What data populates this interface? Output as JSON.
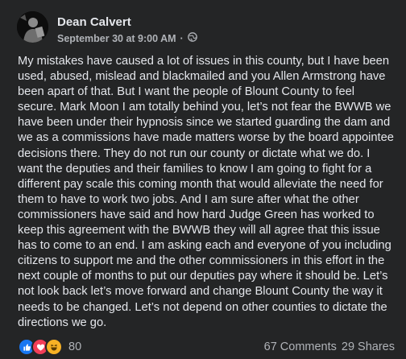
{
  "post": {
    "author": "Dean Calvert",
    "timestamp": "September 30 at 9:00 AM",
    "separator": "·",
    "privacy_icon": "globe-icon",
    "body": "My mistakes have caused a lot of issues in this county, but I have been used, abused, mislead and blackmailed and you Allen Armstrong have been apart of that. But I want the people of Blount County to feel secure. Mark Moon I am totally behind you, let’s not fear the BWWB we have been under their hypnosis since we started guarding the dam and we as a commissions have  made matters worse by the board appointee decisions there. They do not run our county or dictate what we do. I want the deputies and their families to know I am going to fight for a different pay scale this coming month that would alleviate the need for them to have to work two jobs. And I am sure after what the other commissioners have said and how hard Judge Green has worked to keep this agreement with the BWWB they will all agree that this issue has to come to an end. I am asking each and everyone of you including citizens to support me and the other commissioners in this effort in the next couple of months to put our deputies pay where it should be. Let’s not look back let’s move forward and change Blount County the way it needs to be changed. Let’s not depend on other counties to dictate the directions we go."
  },
  "footer": {
    "reactions": [
      "like-icon",
      "love-icon",
      "haha-icon"
    ],
    "reaction_count": "80",
    "comments": "67 Comments",
    "shares": "29 Shares"
  },
  "colors": {
    "background": "#242526",
    "text_primary": "#e4e6eb",
    "text_secondary": "#b0b3b8",
    "like_blue": "#1877f2",
    "love_red": "#f33e58",
    "haha_yellow": "#f7b125"
  }
}
